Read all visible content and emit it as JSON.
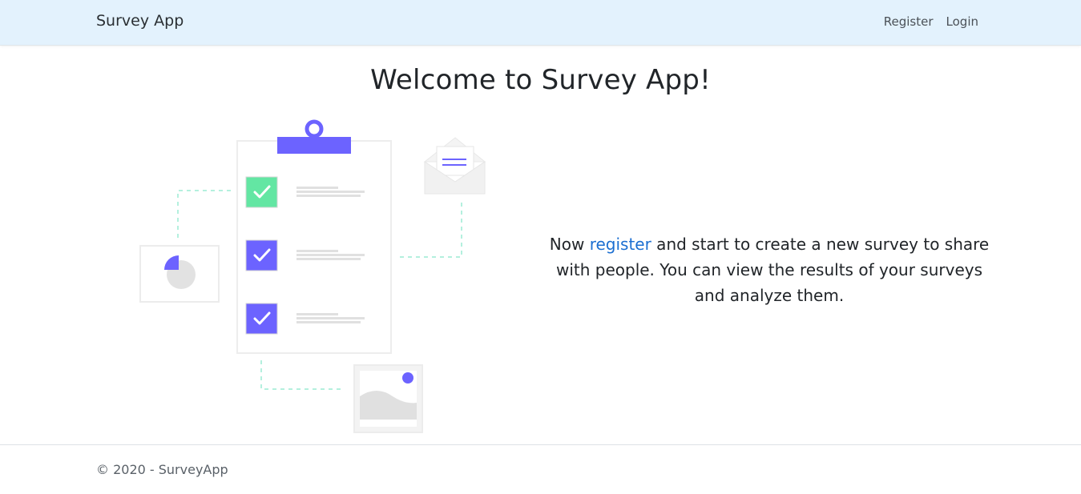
{
  "navbar": {
    "brand": "Survey App",
    "links": [
      {
        "label": "Register"
      },
      {
        "label": "Login"
      }
    ]
  },
  "main": {
    "title": "Welcome to Survey App!",
    "intro_before": "Now ",
    "intro_link": "register",
    "intro_after": " and start to create a new survey to share with people. You can view the results of your surveys and analyze them."
  },
  "illustration": {
    "accent_color": "#6c63ff",
    "check_color": "#63e6a3",
    "dash_color": "#b4f0de",
    "icons": [
      "clipboard-icon",
      "envelope-icon",
      "pie-chart-icon",
      "image-icon",
      "checkbox-icon"
    ]
  },
  "footer": {
    "text": "© 2020 - SurveyApp"
  }
}
